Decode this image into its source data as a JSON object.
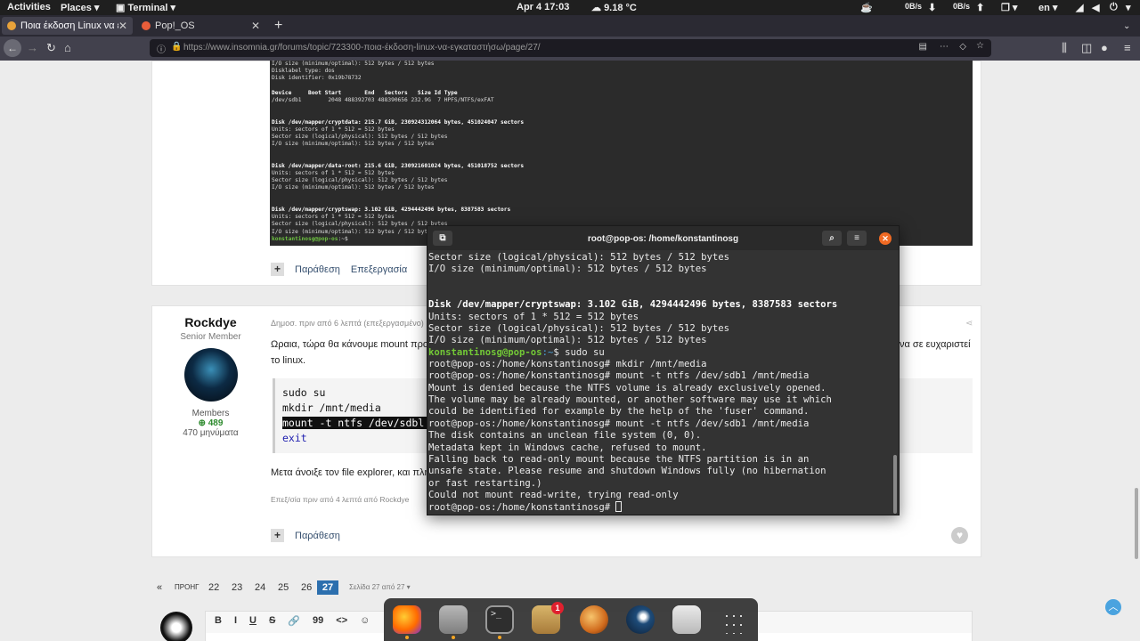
{
  "topbar": {
    "activities": "Activities",
    "places": "Places",
    "terminal": "Terminal",
    "clock": "Apr 4  17:03",
    "weather": "9.18 °C",
    "net_down": "0B/s",
    "net_up": "0B/s",
    "lang": "en"
  },
  "tabs": [
    {
      "label": "Ποια έκδοση Linux να εγκατ"
    },
    {
      "label": "Pop!_OS"
    }
  ],
  "url": {
    "host": "www.insomnia.gr",
    "full": "https://www.insomnia.gr/forums/topic/723300-ποια-έκδοση-linux-να-εγκαταστήσω/page/27/"
  },
  "screenshot_lines": [
    "I/O size (minimum/optimal): 512 bytes / 512 bytes",
    "Disklabel type: dos",
    "Disk identifier: 0x19b78732",
    "",
    "Device     Boot Start       End   Sectors   Size Id Type",
    "/dev/sdb1        2048 488392703 488390656 232.9G  7 HPFS/NTFS/exFAT",
    "",
    "",
    "Disk /dev/mapper/cryptdata: 215.7 GiB, 230924312064 bytes, 451024047 sectors",
    "Units: sectors of 1 * 512 = 512 bytes",
    "Sector size (logical/physical): 512 bytes / 512 bytes",
    "I/O size (minimum/optimal): 512 bytes / 512 bytes",
    "",
    "",
    "Disk /dev/mapper/data-root: 215.6 GiB, 230921601024 bytes, 451018752 sectors",
    "Units: sectors of 1 * 512 = 512 bytes",
    "Sector size (logical/physical): 512 bytes / 512 bytes",
    "I/O size (minimum/optimal): 512 bytes / 512 bytes",
    "",
    "",
    "Disk /dev/mapper/cryptswap: 3.102 GiB, 4294442496 bytes, 8387583 sectors",
    "Units: sectors of 1 * 512 = 512 bytes",
    "Sector size (logical/physical): 512 bytes / 512 bytes",
    "I/O size (minimum/optimal): 512 bytes / 512 bytes"
  ],
  "screenshot_prompt": {
    "user": "konstantinosg@pop-os",
    "path": ":~$"
  },
  "post1": {
    "quote": "Παράθεση",
    "edit": "Επεξεργασία"
  },
  "post2": {
    "author": "Rockdye",
    "role": "Senior Member",
    "group": "Members",
    "reputation": "489",
    "posts": "470 μηνύματα",
    "meta": "Δημοσ. πριν από 6 λεπτά (επεξεργασμένο)",
    "text1": "Ωραια, τώρα θα κάνουμε mount προς",
    "text1_end": "να σε ευχαριστεί",
    "text1_line2": "το linux.",
    "code": [
      "sudo su",
      "mkdir /mnt/media",
      "mount -t ntfs /dev/sdbl /n",
      "exit"
    ],
    "text2": "Μετα άνοιξε τον file explorer, και πλη",
    "edited": "Επεξ/σία πριν από 4 λεπτά από Rockdye",
    "quote": "Παράθεση"
  },
  "pagination": {
    "prev": "ΠΡΟΗΓ",
    "pages": [
      "22",
      "23",
      "24",
      "25",
      "26",
      "27"
    ],
    "current": "27",
    "summary": "Σελίδα 27 από 27"
  },
  "editor": {
    "buttons": [
      "B",
      "I",
      "U",
      "S",
      "🔗",
      "99",
      "<>",
      "☺"
    ]
  },
  "dock": {
    "badge": "1"
  },
  "terminal": {
    "title": "root@pop-os: /home/konstantinosg",
    "lines": [
      {
        "t": "Sector size (logical/physical): 512 bytes / 512 bytes"
      },
      {
        "t": "I/O size (minimum/optimal): 512 bytes / 512 bytes"
      },
      {
        "t": ""
      },
      {
        "t": ""
      },
      {
        "t": "Disk /dev/mapper/cryptswap: 3.102 GiB, 4294442496 bytes, 8387583 sectors",
        "b": true
      },
      {
        "t": "Units: sectors of 1 * 512 = 512 bytes"
      },
      {
        "t": "Sector size (logical/physical): 512 bytes / 512 bytes"
      },
      {
        "t": "I/O size (minimum/optimal): 512 bytes / 512 bytes"
      },
      {
        "user": "konstantinosg@pop-os",
        "path": ":~",
        "t": "$ sudo su"
      },
      {
        "t": "root@pop-os:/home/konstantinosg# mkdir /mnt/media"
      },
      {
        "t": "root@pop-os:/home/konstantinosg# mount -t ntfs /dev/sdb1 /mnt/media"
      },
      {
        "t": "Mount is denied because the NTFS volume is already exclusively opened."
      },
      {
        "t": "The volume may be already mounted, or another software may use it which"
      },
      {
        "t": "could be identified for example by the help of the 'fuser' command."
      },
      {
        "t": "root@pop-os:/home/konstantinosg# mount -t ntfs /dev/sdb1 /mnt/media"
      },
      {
        "t": "The disk contains an unclean file system (0, 0)."
      },
      {
        "t": "Metadata kept in Windows cache, refused to mount."
      },
      {
        "t": "Falling back to read-only mount because the NTFS partition is in an"
      },
      {
        "t": "unsafe state. Please resume and shutdown Windows fully (no hibernation"
      },
      {
        "t": "or fast restarting.)"
      },
      {
        "t": "Could not mount read-write, trying read-only"
      },
      {
        "t": "root@pop-os:/home/konstantinosg# ",
        "cursor": true
      }
    ]
  }
}
